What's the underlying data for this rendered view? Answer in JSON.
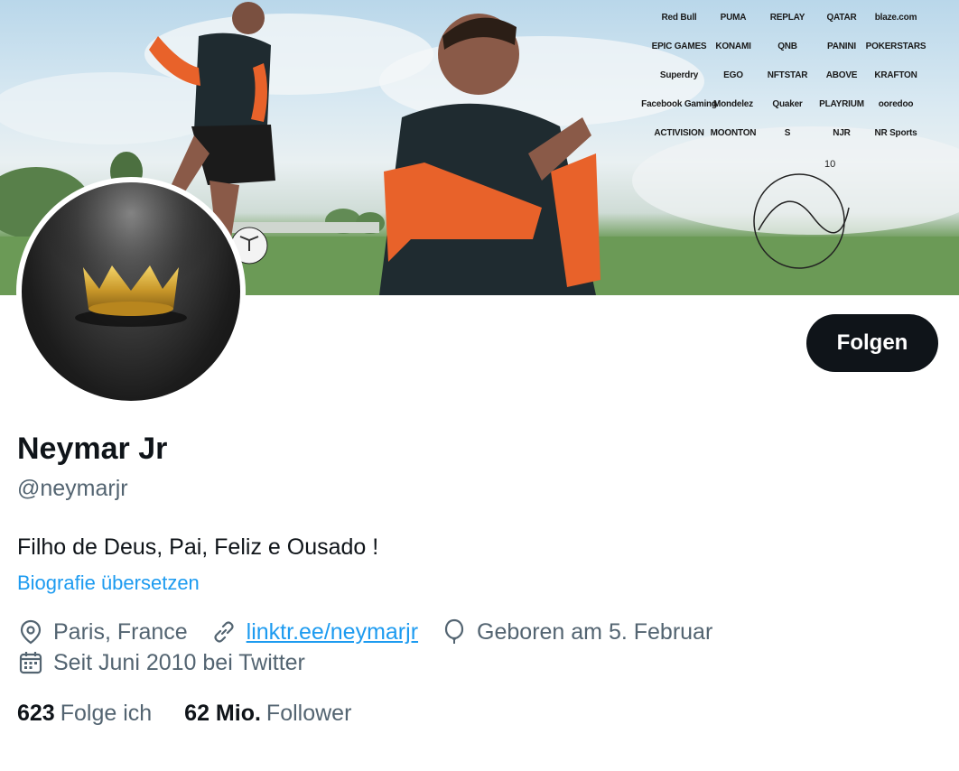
{
  "banner": {
    "sponsors": [
      "Red Bull",
      "PUMA",
      "REPLAY",
      "QATAR",
      "blaze.com",
      "EPIC GAMES",
      "KONAMI",
      "QNB",
      "PANINI",
      "POKERSTARS",
      "Superdry",
      "EGO",
      "NFTSTAR",
      "ABOVE",
      "KRAFTON",
      "Facebook Gaming",
      "Mondelez",
      "Quaker",
      "PLAYRIUM",
      "ooredoo",
      "ACTIVISION",
      "MOONTON",
      "S",
      "NJR",
      "NR Sports"
    ],
    "signature_number": "10"
  },
  "profile": {
    "name": "Neymar Jr",
    "handle": "@neymarjr",
    "bio": "Filho de Deus, Pai, Feliz e Ousado !",
    "translate_label": "Biografie übersetzen",
    "follow_label": "Folgen",
    "location": "Paris, France",
    "link": "linktr.ee/neymarjr",
    "birthday": "Geboren am 5. Februar",
    "joined": "Seit Juni 2010 bei Twitter"
  },
  "stats": {
    "following_count": "623",
    "following_label": "Folge ich",
    "followers_count": "62 Mio.",
    "followers_label": "Follower"
  },
  "colors": {
    "accent": "#1d9bf0",
    "text_primary": "#0f1419",
    "text_secondary": "#536471",
    "button_bg": "#0f1419"
  },
  "icons": {
    "location": "location-pin-icon",
    "link": "link-icon",
    "birthday": "balloon-icon",
    "joined": "calendar-icon"
  }
}
